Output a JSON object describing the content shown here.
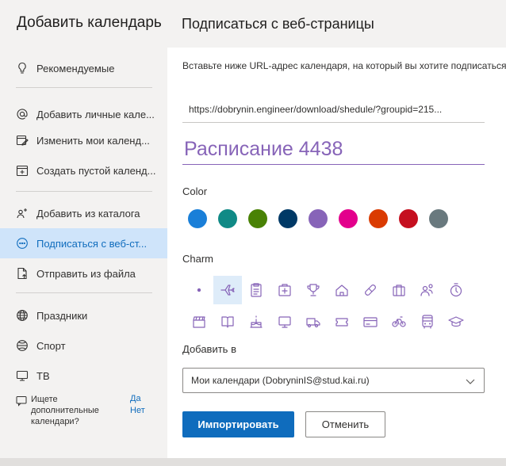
{
  "sidebar": {
    "title": "Добавить календарь",
    "items": [
      {
        "label": "Рекомендуемые",
        "icon": "lightbulb-icon"
      },
      {
        "label": "Добавить личные кале...",
        "icon": "at-icon"
      },
      {
        "label": "Изменить мои календ...",
        "icon": "edit-calendar-icon"
      },
      {
        "label": "Создать пустой календ...",
        "icon": "add-calendar-icon"
      },
      {
        "label": "Добавить из каталога",
        "icon": "people-add-icon"
      },
      {
        "label": "Подписаться с веб-ст...",
        "icon": "globe-link-icon"
      },
      {
        "label": "Отправить из файла",
        "icon": "file-upload-icon"
      },
      {
        "label": "Праздники",
        "icon": "globe-icon"
      },
      {
        "label": "Спорт",
        "icon": "sport-icon"
      },
      {
        "label": "ТВ",
        "icon": "tv-icon"
      }
    ],
    "hint": {
      "text": "Ищете дополнительные календари?",
      "yes": "Да",
      "no": "Нет",
      "icon": "feedback-icon"
    }
  },
  "main": {
    "title": "Подписаться с веб-страницы",
    "description": "Вставьте ниже URL-адрес календаря, на который вы хотите подписаться.",
    "url_value": "https://dobrynin.engineer/download/shedule/?groupid=215...",
    "calendar_name": "Расписание 4438",
    "color_label": "Color",
    "colors": [
      "#1a7fd8",
      "#108a86",
      "#498205",
      "#003966",
      "#8764b8",
      "#e3008c",
      "#da3b01",
      "#c50f1f",
      "#69797e"
    ],
    "charm_label": "Charm",
    "charms_row1": [
      "dot-icon",
      "airplane-icon",
      "clipboard-icon",
      "first-aid-icon",
      "trophy-icon",
      "home-icon",
      "pill-icon",
      "briefcase-icon",
      "people-icon",
      "timer-icon"
    ],
    "charms_row2": [
      "clapperboard-icon",
      "book-icon",
      "cake-icon",
      "monitor-icon",
      "truck-icon",
      "ticket-icon",
      "credit-card-icon",
      "bicycle-icon",
      "bus-icon",
      "graduation-cap-icon"
    ],
    "add_to_label": "Добавить в",
    "add_to_value": "Мои календари (DobryninIS@stud.kai.ru)",
    "import_button": "Импортировать",
    "cancel_button": "Отменить"
  },
  "accent_color": "#0f6cbd",
  "charm_color": "#8764b8"
}
